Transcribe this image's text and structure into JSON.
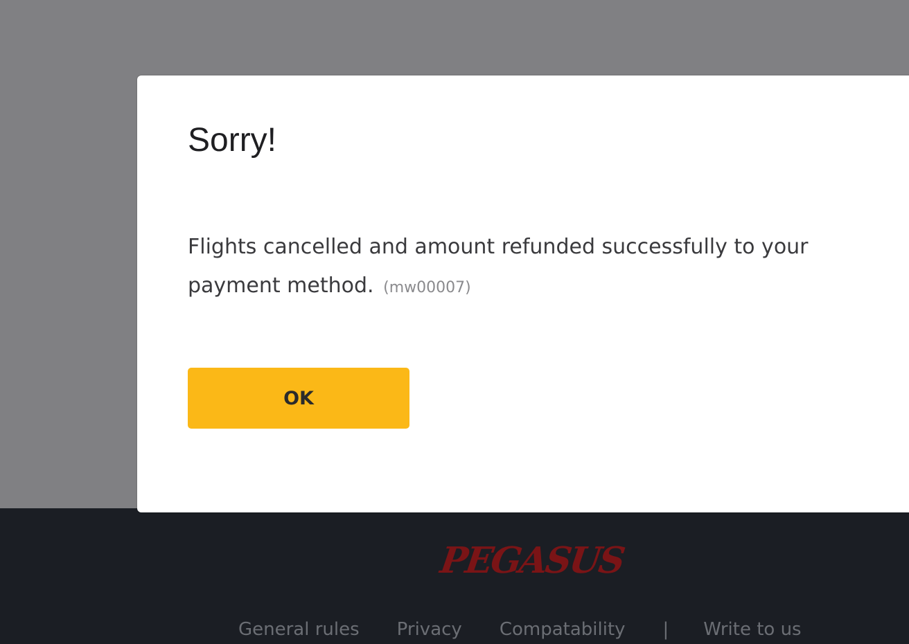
{
  "modal": {
    "title": "Sorry!",
    "message": "Flights cancelled and amount refunded successfully to your payment method.",
    "code": "(mw00007)",
    "ok_label": "OK"
  },
  "footer": {
    "logo_text": "PEGASUS",
    "links": [
      "General rules",
      "Privacy",
      "Compatability",
      "Write to us"
    ],
    "separator": "|"
  },
  "colors": {
    "overlay": "#808083",
    "footer_bg": "#1b1e24",
    "button_bg": "#fbb817",
    "logo": "#7a1416"
  }
}
